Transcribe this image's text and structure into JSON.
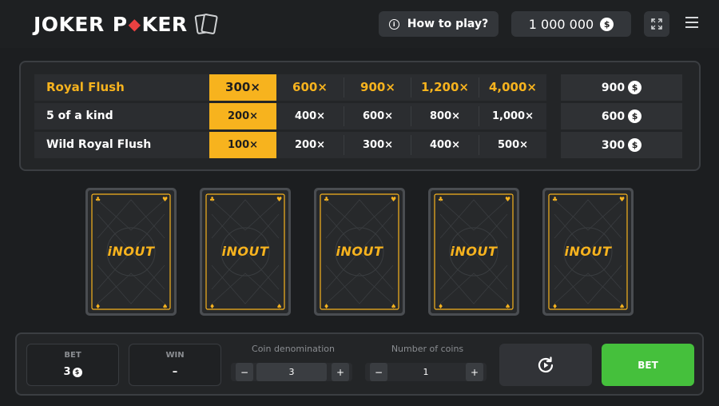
{
  "header": {
    "logo_text": "JOKER POKER",
    "logo_word1": "JOKER",
    "logo_word2_pre": "P",
    "logo_word2_post": "KER",
    "how_to_play": "How to play?",
    "balance": "1 000 000",
    "currency_symbol": "$"
  },
  "paytable": {
    "rows": [
      {
        "hand": "Royal Flush",
        "multipliers": [
          "300×",
          "600×",
          "900×",
          "1,200×",
          "4,000×"
        ],
        "payout": "900"
      },
      {
        "hand": "5 of a kind",
        "multipliers": [
          "200×",
          "400×",
          "600×",
          "800×",
          "1,000×"
        ],
        "payout": "600"
      },
      {
        "hand": "Wild Royal Flush",
        "multipliers": [
          "100×",
          "200×",
          "300×",
          "400×",
          "500×"
        ],
        "payout": "300"
      }
    ],
    "active_column": 1
  },
  "cards": {
    "back_logo": "iNOUT",
    "count": 5
  },
  "controls": {
    "bet_label": "BET",
    "bet_value": "3",
    "win_label": "WIN",
    "win_value": "–",
    "coin_denomination_label": "Coin denomination",
    "coin_denomination_value": "3",
    "number_of_coins_label": "Number of coins",
    "number_of_coins_value": "1",
    "minus": "−",
    "plus": "+",
    "bet_button": "BET"
  },
  "colors": {
    "accent": "#f7b31e",
    "bet_button": "#45c03c",
    "background": "#1c1e20",
    "danger_diamond": "#e84141"
  }
}
